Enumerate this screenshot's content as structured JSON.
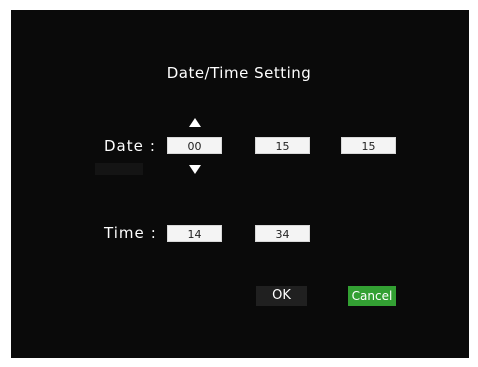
{
  "dialog": {
    "title": "Date/Time Setting"
  },
  "date_row": {
    "label": "Date",
    "separator": ":",
    "fields": [
      "00",
      "15",
      "15"
    ]
  },
  "time_row": {
    "label": "Time",
    "separator": ":",
    "fields": [
      "14",
      "34"
    ]
  },
  "buttons": {
    "ok_label": "OK",
    "cancel_label": "Cancel"
  },
  "colors": {
    "background": "#0a0a0a",
    "cancel_button": "#33a033",
    "ok_button": "#202020",
    "field": "#f4f4f4"
  },
  "icons": {
    "increment": "triangle-up-icon",
    "decrement": "triangle-down-icon"
  }
}
